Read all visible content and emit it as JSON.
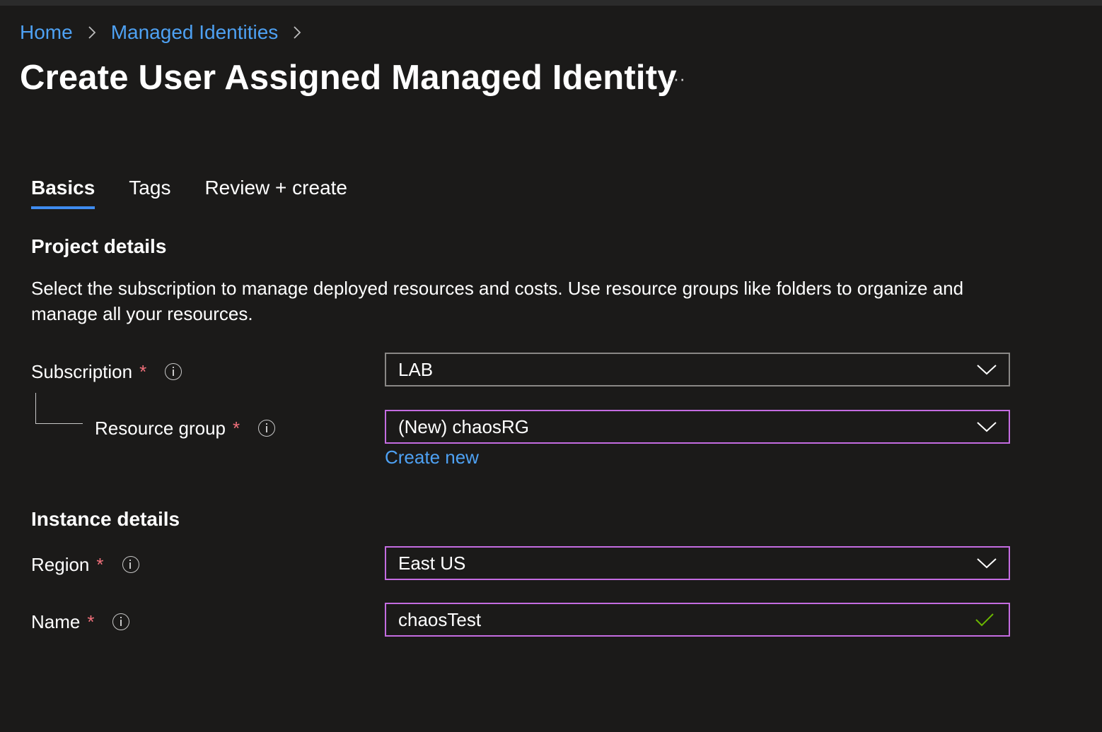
{
  "breadcrumb": {
    "items": [
      {
        "label": "Home"
      },
      {
        "label": "Managed Identities"
      }
    ]
  },
  "page": {
    "title": "Create User Assigned Managed Identity",
    "more_label": "···"
  },
  "tabs": [
    {
      "label": "Basics",
      "active": true
    },
    {
      "label": "Tags",
      "active": false
    },
    {
      "label": "Review + create",
      "active": false
    }
  ],
  "project": {
    "heading": "Project details",
    "description": "Select the subscription to manage deployed resources and costs. Use resource groups like folders to organize and manage all your resources.",
    "subscription": {
      "label": "Subscription",
      "required": "*",
      "value": "LAB"
    },
    "resource_group": {
      "label": "Resource group",
      "required": "*",
      "value": "(New) chaosRG",
      "create_new": "Create new"
    }
  },
  "instance": {
    "heading": "Instance details",
    "region": {
      "label": "Region",
      "required": "*",
      "value": "East US"
    },
    "name": {
      "label": "Name",
      "required": "*",
      "value": "chaosTest"
    }
  },
  "colors": {
    "background": "#1b1a19",
    "link": "#4ea1f3",
    "focus_border": "#c46ce1",
    "required": "#f1707b",
    "valid_check": "#6bb700",
    "tab_underline": "#3f8cf0"
  },
  "icons": {
    "breadcrumb_separator": "chevron-right-icon",
    "dropdown": "chevron-down-icon",
    "info": "info-icon",
    "valid": "checkmark-icon"
  }
}
